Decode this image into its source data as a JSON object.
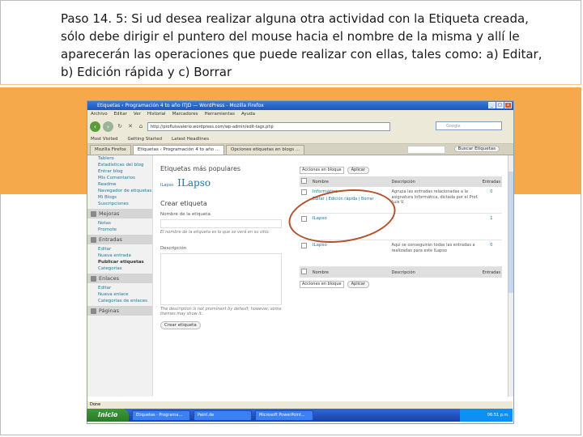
{
  "caption": "Paso 14. 5: Si ud desea realizar alguna otra actividad con la Etiqueta creada, sólo debe dirigir el puntero del mouse hacia el nombre de la misma y allí le aparecerán las operaciones que puede realizar con ellas, tales como: a) Editar, b) Edición rápida y c) Borrar",
  "colors": {
    "accent_band": "#f6a94a",
    "annotation_oval": "#b3522c",
    "link": "#21759b"
  },
  "browser": {
    "window_title": "Etiquetas ‹ Programación 4 to año ITJD — WordPress - Mozilla Firefox",
    "menu": [
      "Archivo",
      "Editar",
      "Ver",
      "Historial",
      "Marcadores",
      "Herramientas",
      "Ayuda"
    ],
    "url": "http://profluisvalerio.wordpress.com/wp-admin/edit-tags.php",
    "search_placeholder": "Google",
    "bookmarks": [
      "Most Visited",
      "Getting Started",
      "Latest Headlines"
    ],
    "tabs": [
      "Mozilla Firefox",
      "Etiquetas ‹ Programación 4 to año ...",
      "Opciones etiquetas en blogs ..."
    ]
  },
  "sidebar": {
    "items_top": [
      "Tablero",
      "Estadísticas del blog",
      "Entrar blog",
      "Mis Comentarios",
      "Readme",
      "Navegador de etiquetas",
      "Mi Blogs",
      "Suscripciones"
    ],
    "mejoras_head": "Mejoras",
    "mejoras_items": [
      "Notas",
      "Promote"
    ],
    "entradas_head": "Entradas",
    "entradas_items": [
      "Editar",
      "Nueva entrada",
      "Publicar etiquetas",
      "Categorías"
    ],
    "enlaces_head": "Enlaces",
    "enlaces_items": [
      "Editar",
      "Nueva enlace",
      "Categorías de enlaces"
    ],
    "paginas_head": "Páginas"
  },
  "popular": {
    "heading": "Etiquetas más populares",
    "small": "ILapso",
    "big": "ILapso"
  },
  "crear": {
    "heading": "Crear etiqueta",
    "name_label": "Nombre de la etiqueta",
    "name_help": "El nombre de la etiqueta es lo que se verá en su sitio.",
    "desc_label": "Descripción",
    "desc_help": "The description is not prominent by default; however, some themes may show it.",
    "button": "Crear etiqueta"
  },
  "table": {
    "search_button": "Buscar Etiquetas",
    "bulk_select": "Acciones en bloque",
    "apply": "Aplicar",
    "headers": {
      "name": "Nombre",
      "desc": "Descripción",
      "count": "Entradas"
    },
    "rows": [
      {
        "name": "Informática",
        "actions": "Editar | Edición rápida | Borrar",
        "desc": "Agrupa las entradas relacionadas a la asignatura Informática, dictada por el Prof. Luis V.",
        "count": "0"
      },
      {
        "name": "ILapso",
        "actions": "",
        "desc": "",
        "count": "1"
      },
      {
        "name": "ILapso",
        "actions": "",
        "desc": "Aquí se conseguirán todas las entradas a realizadas para este ILapso",
        "count": "0"
      }
    ]
  },
  "status": "Done",
  "taskbar": {
    "start": "Inicio",
    "tasks": [
      "Etiquetas · Programa...",
      "Paint.de",
      "Microsoft PowerPoint..."
    ],
    "clock": "06:51 p.m."
  }
}
